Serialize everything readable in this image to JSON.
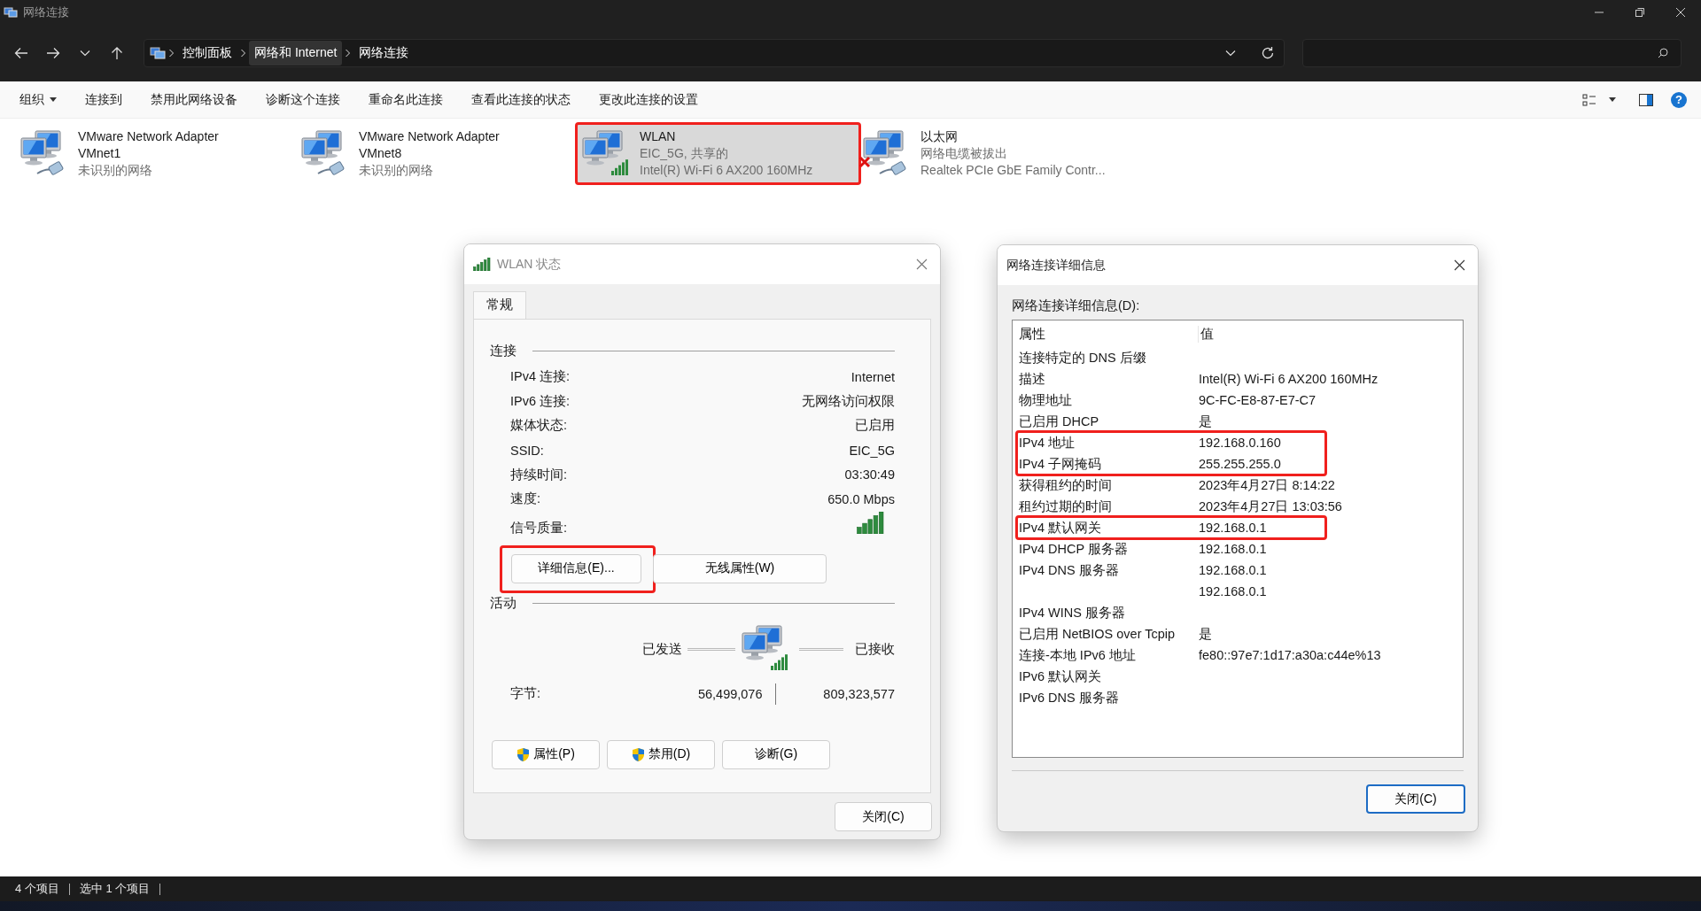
{
  "window": {
    "title": "网络连接"
  },
  "address_bar": {
    "path": [
      {
        "label": "控制面板",
        "hovered": false
      },
      {
        "label": "网络和 Internet",
        "hovered": true
      },
      {
        "label": "网络连接",
        "hovered": false
      }
    ]
  },
  "toolbar": {
    "items": [
      {
        "label": "组织",
        "dropdown": true
      },
      {
        "label": "连接到",
        "dropdown": false
      },
      {
        "label": "禁用此网络设备",
        "dropdown": false
      },
      {
        "label": "诊断这个连接",
        "dropdown": false
      },
      {
        "label": "重命名此连接",
        "dropdown": false
      },
      {
        "label": "查看此连接的状态",
        "dropdown": false
      },
      {
        "label": "更改此连接的设置",
        "dropdown": false
      }
    ],
    "help": "?"
  },
  "adapters": [
    {
      "name": "VMware Network Adapter VMnet1",
      "lines": [
        "未识别的网络"
      ],
      "kind": "wired",
      "disconnected": false,
      "selected": false,
      "highlighted": false
    },
    {
      "name": "VMware Network Adapter VMnet8",
      "lines": [
        "未识别的网络"
      ],
      "kind": "wired",
      "disconnected": false,
      "selected": false,
      "highlighted": false
    },
    {
      "name": "WLAN",
      "lines": [
        "EIC_5G, 共享的",
        "Intel(R) Wi-Fi 6 AX200 160MHz"
      ],
      "kind": "wireless",
      "disconnected": false,
      "selected": true,
      "highlighted": true
    },
    {
      "name": "以太网",
      "lines": [
        "网络电缆被拔出",
        "Realtek PCIe GbE Family Contr..."
      ],
      "kind": "wired",
      "disconnected": true,
      "selected": false,
      "highlighted": false
    }
  ],
  "status_dialog": {
    "title": "WLAN 状态",
    "tabs": [
      {
        "label": "常规",
        "selected": true
      }
    ],
    "connection": {
      "heading": "连接",
      "rows": [
        {
          "label": "IPv4 连接:",
          "value": "Internet"
        },
        {
          "label": "IPv6 连接:",
          "value": "无网络访问权限"
        },
        {
          "label": "媒体状态:",
          "value": "已启用"
        },
        {
          "label": "SSID:",
          "value": "EIC_5G"
        },
        {
          "label": "持续时间:",
          "value": "03:30:49"
        },
        {
          "label": "速度:",
          "value": "650.0 Mbps"
        }
      ],
      "signal_label": "信号质量:"
    },
    "buttons": [
      {
        "label": "详细信息(E)...",
        "highlighted": true
      },
      {
        "label": "无线属性(W)",
        "highlighted": false
      }
    ],
    "activity": {
      "heading": "活动",
      "sent_label": "已发送",
      "received_label": "已接收",
      "bytes_label": "字节:",
      "bytes_sent": "56,499,076",
      "bytes_received": "809,323,577"
    },
    "action_buttons": [
      {
        "label": "属性(P)",
        "shield": true
      },
      {
        "label": "禁用(D)",
        "shield": true
      },
      {
        "label": "诊断(G)",
        "shield": false
      }
    ],
    "close_button": {
      "label": "关闭(C)",
      "default": false
    }
  },
  "details_dialog": {
    "title": "网络连接详细信息",
    "list_label": "网络连接详细信息(D):",
    "columns": [
      "属性",
      "值"
    ],
    "rows": [
      {
        "property": "连接特定的 DNS 后缀",
        "highlighted": false
      },
      {
        "property": "描述",
        "value": "Intel(R) Wi-Fi 6 AX200 160MHz",
        "highlighted": false
      },
      {
        "property": "物理地址",
        "value": "9C-FC-E8-87-E7-C7",
        "highlighted": false
      },
      {
        "property": "已启用 DHCP",
        "value": "是",
        "highlighted": false
      },
      {
        "property": "IPv4 地址",
        "value": "192.168.0.160",
        "highlighted": true
      },
      {
        "property": "IPv4 子网掩码",
        "value": "255.255.255.0",
        "highlighted": true
      },
      {
        "property": "获得租约的时间",
        "value": "2023年4月27日 8:14:22",
        "highlighted": false
      },
      {
        "property": "租约过期的时间",
        "value": "2023年4月27日 13:03:56",
        "highlighted": false
      },
      {
        "property": "IPv4 默认网关",
        "value": "192.168.0.1",
        "highlighted": true
      },
      {
        "property": "IPv4 DHCP 服务器",
        "value": "192.168.0.1",
        "highlighted": false
      },
      {
        "property": "IPv4 DNS 服务器",
        "value": "192.168.0.1",
        "highlighted": false
      },
      {
        "value": "192.168.0.1",
        "highlighted": false
      },
      {
        "property": "IPv4 WINS 服务器",
        "highlighted": false
      },
      {
        "property": "已启用 NetBIOS over Tcpip",
        "value": "是",
        "highlighted": false
      },
      {
        "property": "连接-本地 IPv6 地址",
        "value": "fe80::97e7:1d17:a30a:c44e%13",
        "highlighted": false
      },
      {
        "property": "IPv6 默认网关",
        "highlighted": false
      },
      {
        "property": "IPv6 DNS 服务器",
        "highlighted": false
      }
    ],
    "close_button": {
      "label": "关闭(C)",
      "default": true
    }
  },
  "status_bar": {
    "item_count": "4 个项目",
    "selection": "选中 1 个项目"
  }
}
